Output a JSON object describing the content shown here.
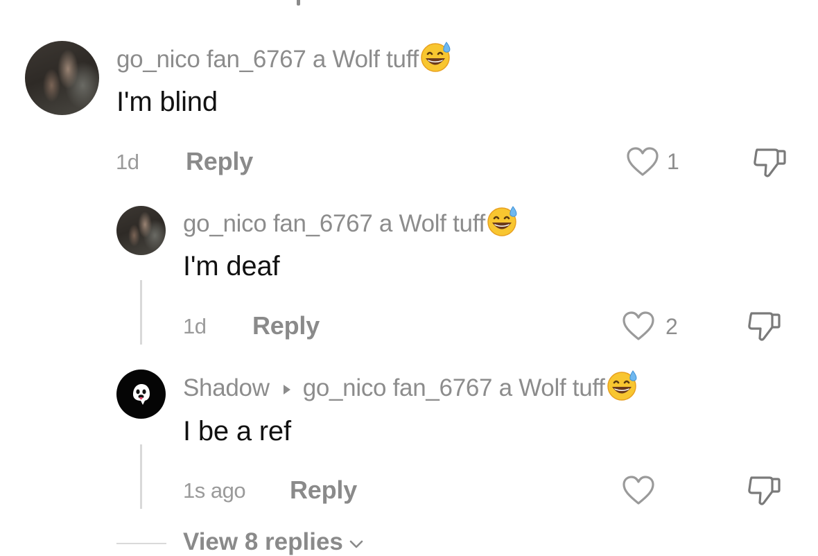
{
  "comments": [
    {
      "username": "go_nico fan_6767 a Wolf tuff",
      "emoji": "grinning-sweat-emoji",
      "text": "I'm blind",
      "time": "1d",
      "reply_label": "Reply",
      "likes": "1"
    },
    {
      "username": "go_nico fan_6767 a Wolf tuff",
      "emoji": "grinning-sweat-emoji",
      "text": "I'm deaf",
      "time": "1d",
      "reply_label": "Reply",
      "likes": "2"
    },
    {
      "username": "Shadow",
      "reply_to": "go_nico fan_6767 a Wolf tuff",
      "emoji": "grinning-sweat-emoji",
      "avatar_icon": "ghost-icon",
      "text": "I be a ref",
      "time": "1s ago",
      "reply_label": "Reply",
      "likes": ""
    }
  ],
  "view_replies": "View 8 replies",
  "colors": {
    "username": "#8c8c8c",
    "text": "#111111",
    "meta": "#9a9a9a",
    "line": "#d9d9d9"
  }
}
